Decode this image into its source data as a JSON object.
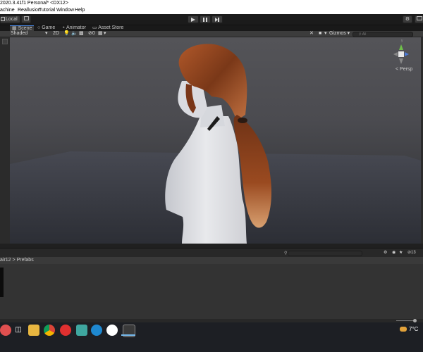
{
  "window": {
    "title": "2020.3.41f1 Personal* <DX12>",
    "menu": [
      "achine",
      "Reallusion",
      "Tutorial",
      "Window",
      "Help"
    ]
  },
  "toolbar": {
    "pivot_label": "Local",
    "play_icon": "play-icon",
    "pause_icon": "pause-icon",
    "step_icon": "step-icon"
  },
  "tabs": [
    "Scene",
    "Game",
    "Animator",
    "Asset Store"
  ],
  "scene_options": {
    "shading_mode": "Shaded",
    "mode_2d": "2D",
    "hidden_count": "0",
    "gizmos_label": "Gizmos",
    "search_placeholder": "All"
  },
  "orientation_gizmo": {
    "y_label": "y",
    "projection_label": "< Persp"
  },
  "project": {
    "breadcrumb_suffix": "air12",
    "breadcrumb_separator": ">",
    "breadcrumb_folder": "Prefabs",
    "hidden_count": "13"
  },
  "taskbar": {
    "temperature": "7°C"
  },
  "colors": {
    "accent": "#4a8ae8",
    "hair": "#8a3d18",
    "skin": "#d9dbe0",
    "floor": "#3a3c44",
    "taskbar_active": "#76b9ed"
  }
}
